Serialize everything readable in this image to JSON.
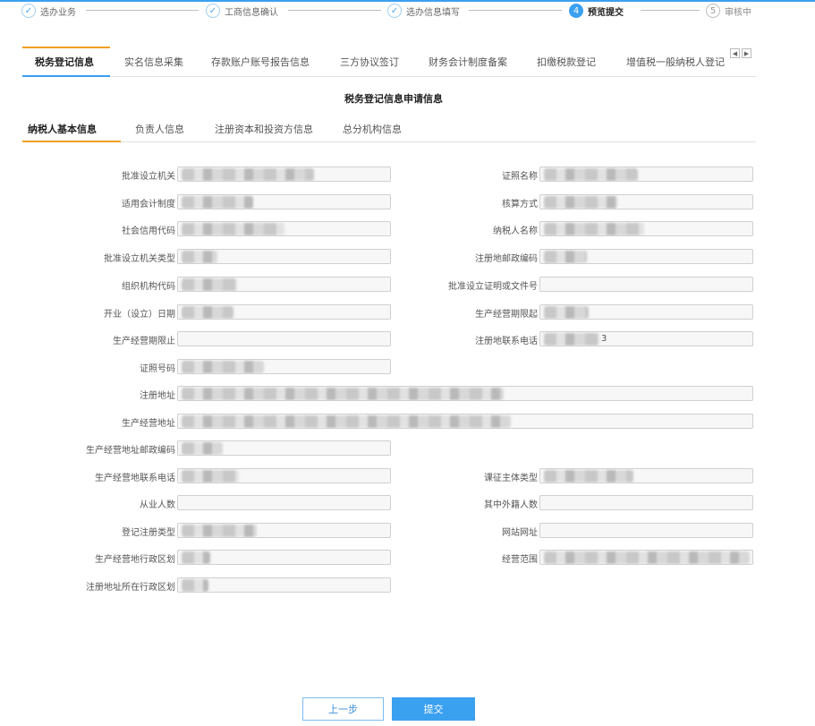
{
  "steps": [
    {
      "num": "✓",
      "label": "选办业务"
    },
    {
      "num": "✓",
      "label": "工商信息确认"
    },
    {
      "num": "✓",
      "label": "选办信息填写"
    },
    {
      "num": "4",
      "label": "预览提交"
    },
    {
      "num": "5",
      "label": "审核中"
    }
  ],
  "tabs": [
    "税务登记信息",
    "实名信息采集",
    "存款账户账号报告信息",
    "三方协议签订",
    "财务会计制度备案",
    "扣缴税款登记",
    "增值税一般纳税人登记"
  ],
  "scroll": {
    "left": "◀",
    "right": "▶"
  },
  "form_title": "税务登记信息申请信息",
  "subtabs": [
    "纳税人基本信息",
    "负责人信息",
    "注册资本和投资方信息",
    "总分机构信息"
  ],
  "fields": {
    "approval_org": {
      "label": "批准设立机关",
      "value": ""
    },
    "cert_name": {
      "label": "证照名称",
      "value": ""
    },
    "accounting_system": {
      "label": "适用会计制度",
      "value": ""
    },
    "accounting_method": {
      "label": "核算方式",
      "value": ""
    },
    "credit_code": {
      "label": "社会信用代码",
      "value": ""
    },
    "taxpayer_name": {
      "label": "纳税人名称",
      "value": ""
    },
    "approval_org_type": {
      "label": "批准设立机关类型",
      "value": ""
    },
    "reg_postcode": {
      "label": "注册地邮政编码",
      "value": ""
    },
    "org_code": {
      "label": "组织机构代码",
      "value": ""
    },
    "approval_doc_no": {
      "label": "批准设立证明或文件号",
      "value": ""
    },
    "open_date": {
      "label": "开业（设立）日期",
      "value": ""
    },
    "biz_start": {
      "label": "生产经营期限起",
      "value": ""
    },
    "biz_end": {
      "label": "生产经营期限止",
      "value": ""
    },
    "reg_phone": {
      "label": "注册地联系电话",
      "value": "3"
    },
    "cert_no": {
      "label": "证照号码",
      "value": ""
    },
    "reg_address": {
      "label": "注册地址",
      "value": ""
    },
    "biz_address": {
      "label": "生产经营地址",
      "value": ""
    },
    "biz_postcode": {
      "label": "生产经营地址邮政编码",
      "value": ""
    },
    "biz_phone": {
      "label": "生产经营地联系电话",
      "value": ""
    },
    "tax_subject_type": {
      "label": "课征主体类型",
      "value": ""
    },
    "employees": {
      "label": "从业人数",
      "value": ""
    },
    "foreign_employees": {
      "label": "其中外籍人数",
      "value": ""
    },
    "reg_type": {
      "label": "登记注册类型",
      "value": ""
    },
    "website": {
      "label": "网站网址",
      "value": ""
    },
    "biz_region": {
      "label": "生产经营地行政区划",
      "value": ""
    },
    "biz_scope": {
      "label": "经营范围",
      "value": ""
    },
    "reg_region": {
      "label": "注册地址所在行政区划",
      "value": ""
    }
  },
  "buttons": {
    "prev": "上一步",
    "submit": "提交"
  },
  "colors": {
    "accent": "#3aa0f0",
    "tab_indicator": "#f0a020"
  }
}
